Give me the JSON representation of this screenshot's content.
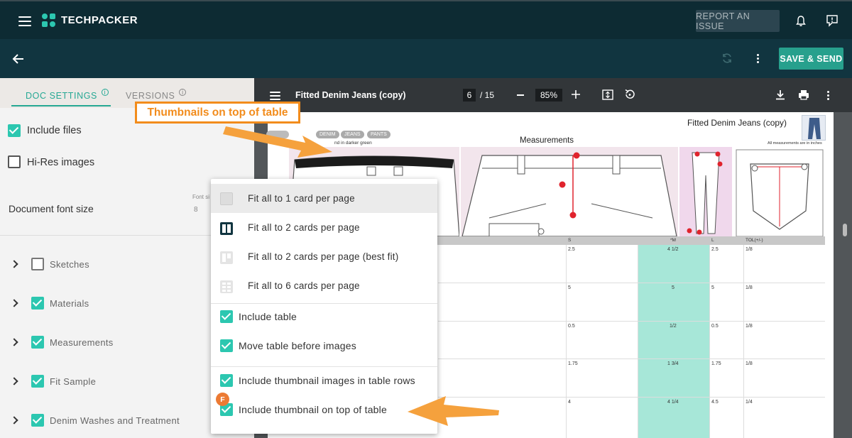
{
  "topbar": {
    "brand": "TECHPACKER",
    "report_label": "REPORT AN ISSUE"
  },
  "subbar": {
    "save_label": "SAVE & SEND"
  },
  "left_panel": {
    "tabs": [
      {
        "label": "DOC SETTINGS",
        "active": true
      },
      {
        "label": "VERSIONS",
        "active": false
      }
    ],
    "options": [
      {
        "label": "Include files",
        "checked": true
      },
      {
        "label": "Hi-Res images",
        "checked": false
      }
    ],
    "font_size": {
      "label": "Document font size",
      "small_label": "Font si",
      "value": "8"
    },
    "sections": [
      {
        "label": "Sketches",
        "checked": false
      },
      {
        "label": "Materials",
        "checked": true
      },
      {
        "label": "Measurements",
        "checked": true
      },
      {
        "label": "Fit Sample",
        "checked": true
      },
      {
        "label": "Denim Washes and Treatment",
        "checked": true
      }
    ]
  },
  "viewer": {
    "title": "Fitted Denim Jeans (copy)",
    "page_current": "6",
    "page_total": "/ 15",
    "zoom": "85%",
    "document": {
      "title": "Fitted Denim Jeans (copy)",
      "heading": "Measurements",
      "tags": [
        "DENIM",
        "JEANS",
        "PANTS"
      ],
      "note_left": "nd in darker green",
      "note_right": "All measurements are in inches",
      "columns": [
        "S",
        "*M",
        "L",
        "TOL(+/-)"
      ],
      "rows": [
        [
          "2.5",
          "4 1/2",
          "2.5",
          "1/8"
        ],
        [
          "5",
          "5",
          "5",
          "1/8"
        ],
        [
          "0.5",
          "1/2",
          "0.5",
          "1/8"
        ],
        [
          "1.75",
          "1 3/4",
          "1.75",
          "1/8"
        ],
        [
          "4",
          "4 1/4",
          "4.5",
          "1/4"
        ]
      ]
    }
  },
  "menu": {
    "layout_options": [
      {
        "label": "Fit all to 1 card per page",
        "highlighted": true
      },
      {
        "label": "Fit all to 2 cards per page",
        "highlighted": false
      },
      {
        "label": "Fit all to 2 cards per page (best fit)",
        "highlighted": false
      },
      {
        "label": "Fit all to 6 cards per page",
        "highlighted": false
      }
    ],
    "table_options": [
      {
        "label": "Include table",
        "checked": true
      },
      {
        "label": "Move table before images",
        "checked": true
      }
    ],
    "thumb_options": [
      {
        "label": "Include thumbnail images in table rows",
        "checked": true
      },
      {
        "label": "Include thumbnail on top of table",
        "checked": true
      }
    ]
  },
  "annotation": {
    "callout": "Thumbnails on top of table",
    "badge": "F",
    "color": "#f28c1c"
  },
  "colors": {
    "topbar": "#0d2b33",
    "accent": "#2cc7b0",
    "save_button": "#27a08d"
  }
}
